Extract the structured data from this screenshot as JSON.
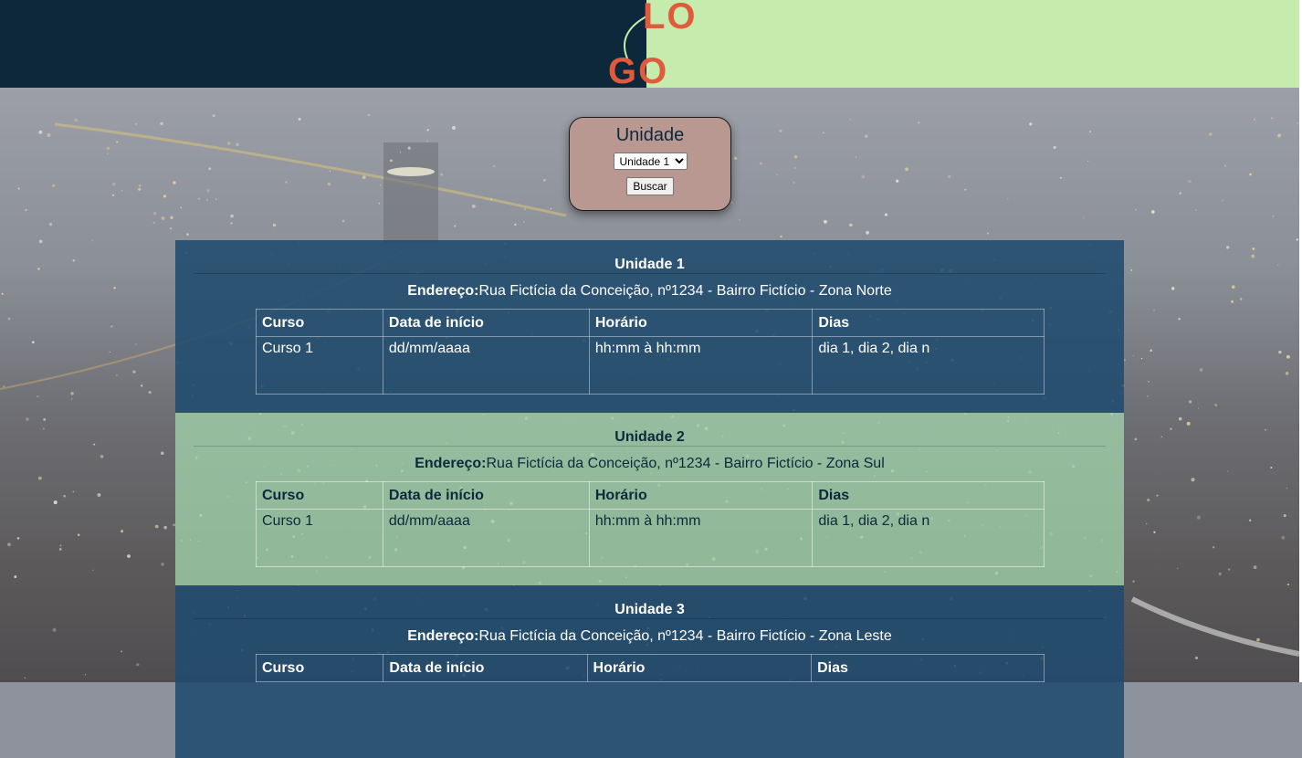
{
  "header": {
    "logo_top": "LO",
    "logo_bottom": "GO",
    "colors": {
      "left": "#0e283b",
      "right": "#c6ecad",
      "logo": "#e05a3c"
    }
  },
  "search": {
    "title": "Unidade",
    "selected": "Unidade 1",
    "button_label": "Buscar"
  },
  "table_headers": [
    "Curso",
    "Data de início",
    "Horário",
    "Dias"
  ],
  "address_label": "Endereço:",
  "units": [
    {
      "name": "Unidade 1",
      "address": "Rua Fictícia da Conceição, nº1234 - Bairro Fictício - Zona Norte",
      "rows": [
        [
          "Curso 1",
          "dd/mm/aaaa",
          "hh:mm à hh:mm",
          "dia 1, dia 2, dia n"
        ]
      ]
    },
    {
      "name": "Unidade 2",
      "address": "Rua Fictícia da Conceição, nº1234 - Bairro Fictício - Zona Sul",
      "rows": [
        [
          "Curso 1",
          "dd/mm/aaaa",
          "hh:mm à hh:mm",
          "dia 1, dia 2, dia n"
        ]
      ]
    },
    {
      "name": "Unidade 3",
      "address": "Rua Fictícia da Conceição, nº1234 - Bairro Fictício - Zona Leste",
      "rows": []
    }
  ]
}
